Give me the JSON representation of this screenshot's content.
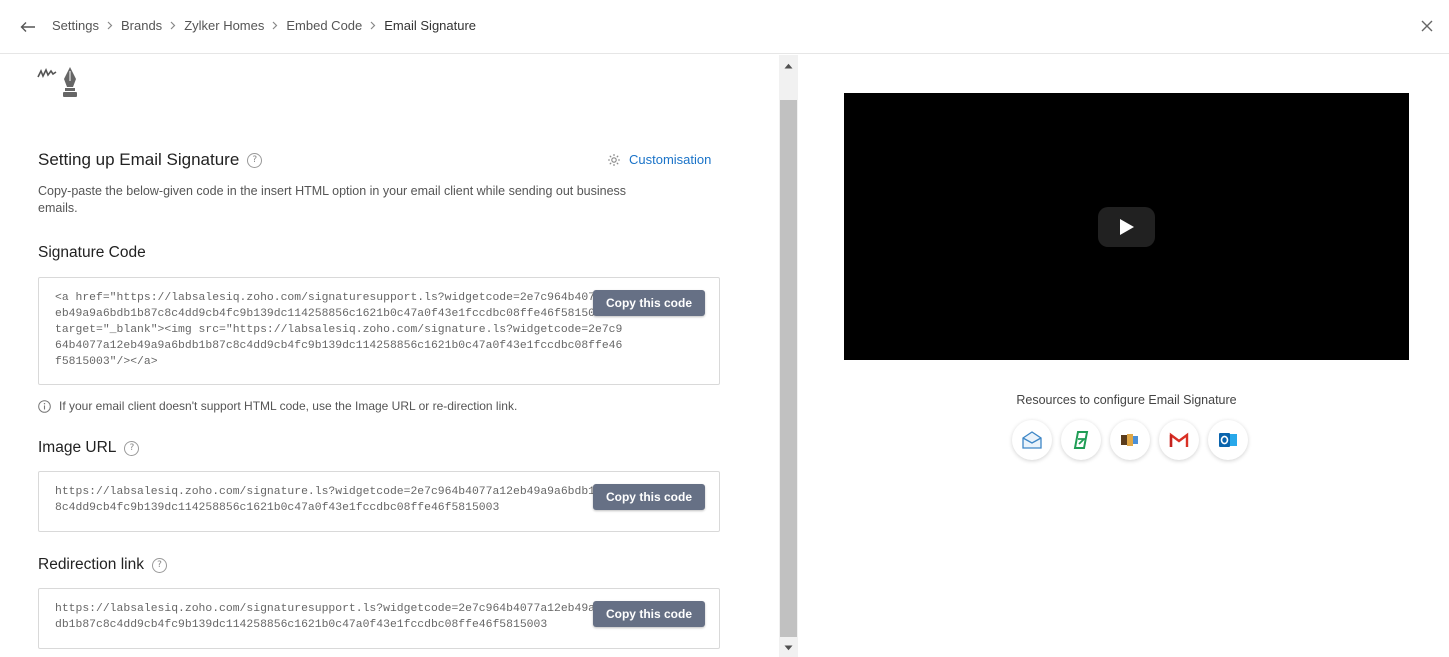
{
  "breadcrumb": {
    "items": [
      "Settings",
      "Brands",
      "Zylker Homes",
      "Embed Code",
      "Email Signature"
    ]
  },
  "main": {
    "title": "Setting up Email Signature",
    "customisation_label": "Customisation",
    "description": "Copy-paste the below-given code in the insert HTML option in your email client while sending out business emails.",
    "signature_code": {
      "label": "Signature Code",
      "code": "<a href=\"https://labsalesiq.zoho.com/signaturesupport.ls?widgetcode=2e7c964b4077a12\neb49a9a6bdb1b87c8c4dd9cb4fc9b139dc114258856c1621b0c47a0f43e1fccdbc08ffe46f5815003\"\ntarget=\"_blank\"><img src=\"https://labsalesiq.zoho.com/signature.ls?widgetcode=2e7c9\n64b4077a12eb49a9a6bdb1b87c8c4dd9cb4fc9b139dc114258856c1621b0c47a0f43e1fccdbc08ffe46\nf5815003\"/></a>",
      "copy_label": "Copy this code"
    },
    "info_text": "If your email client doesn't support HTML code, use the Image URL or re-direction link.",
    "image_url": {
      "label": "Image URL",
      "code": "https://labsalesiq.zoho.com/signature.ls?widgetcode=2e7c964b4077a12eb49a9a6bdb1b87c\n8c4dd9cb4fc9b139dc114258856c1621b0c47a0f43e1fccdbc08ffe46f5815003",
      "copy_label": "Copy this code"
    },
    "redirection_link": {
      "label": "Redirection link",
      "code": "https://labsalesiq.zoho.com/signaturesupport.ls?widgetcode=2e7c964b4077a12eb49a9a6b\ndb1b87c8c4dd9cb4fc9b139dc114258856c1621b0c47a0f43e1fccdbc08ffe46f5815003",
      "copy_label": "Copy this code"
    }
  },
  "resources": {
    "title": "Resources to configure Email Signature",
    "icons": [
      "mail-client-icon",
      "zoho-mail-icon",
      "thunderbird-icon",
      "gmail-icon",
      "outlook-icon"
    ]
  },
  "colors": {
    "accent": "#1a73c8",
    "copy_button": "#667085",
    "video_bg": "#000000"
  }
}
